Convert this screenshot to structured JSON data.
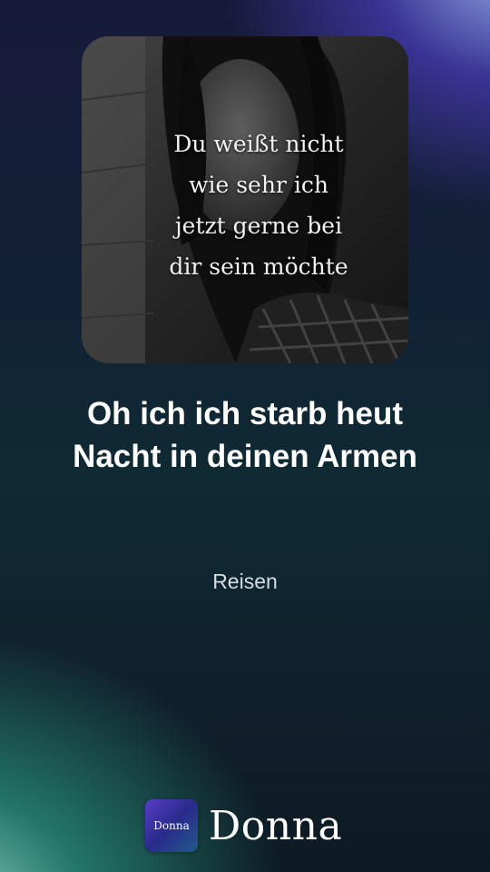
{
  "cover": {
    "quote_lines": [
      "Du weißt nicht",
      "wie sehr ich",
      "jetzt gerne bei",
      "dir sein möchte"
    ]
  },
  "song": {
    "title_line1": "Oh ich ich starb heut",
    "title_line2": "Nacht in deinen Armen",
    "subtitle": "Reisen"
  },
  "brand": {
    "icon_text": "Donna",
    "name": "Donna"
  },
  "colors": {
    "text": "#ffffff",
    "subtitle": "#d6dce0",
    "brand_icon_gradient_start": "#5a3cc8",
    "brand_icon_gradient_end": "#1f5b8a"
  },
  "icons": [
    "brand-logo-icon"
  ]
}
